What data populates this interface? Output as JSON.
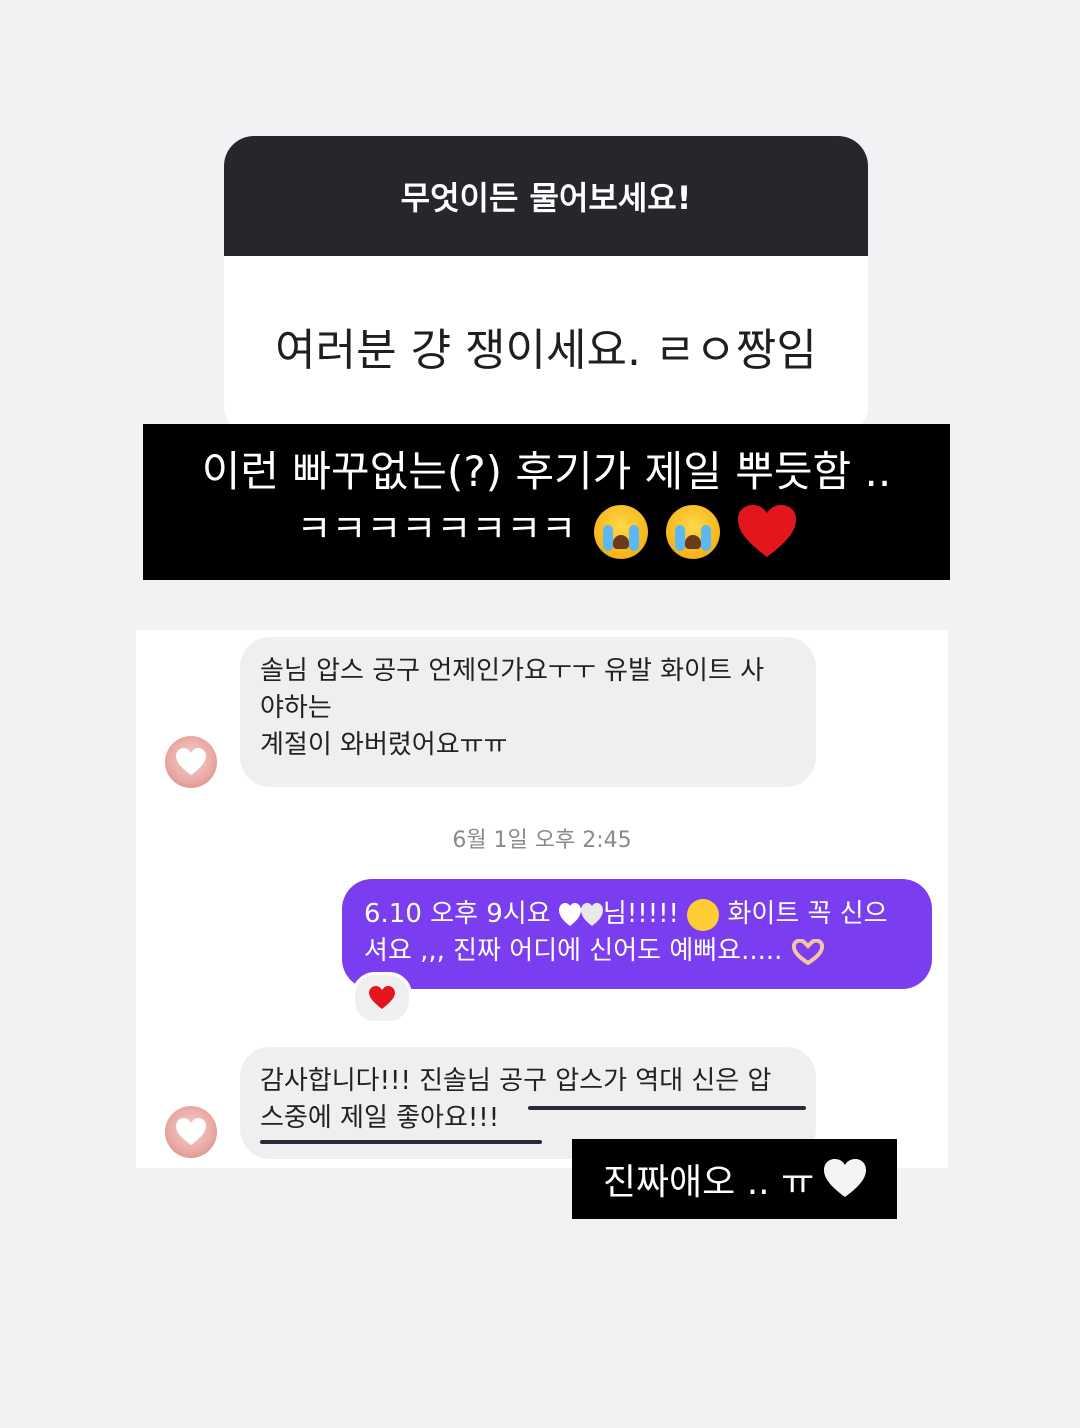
{
  "question_sticker": {
    "prompt": "무엇이든 물어보세요!",
    "answer": "여러분 걍 쟁이세요. ㄹㅇ짱임"
  },
  "banner": {
    "line1": "이런 빠꾸없는(?) 후기가 제일 뿌듯함 ..",
    "line2": "ㅋㅋㅋㅋㅋㅋㅋㅋ",
    "emojis": [
      "crying-face-icon",
      "crying-face-icon",
      "red-heart-icon"
    ]
  },
  "chat": {
    "messages": [
      {
        "from": "them",
        "lines": [
          "솔님 압스 공구 언제인가요ㅜㅜ 유발 화이트 사",
          "야하는",
          "계절이 와버렸어요ㅠㅠ"
        ]
      },
      {
        "from": "me",
        "lines": [
          "6.10 오후 9시요",
          "님!!!!!",
          "화이트 꼭 신으",
          "셔요 ,,, 진짜 어디에 신어도 예뻐요....."
        ],
        "reaction": "red-heart-icon"
      },
      {
        "from": "them",
        "lines": [
          "감사합니다!!! 진솔님 공구 압스가 역대 신은 압",
          "스중에 제일 좋아요!!!"
        ]
      }
    ],
    "timestamp": "6월 1일 오후 2:45"
  },
  "caption2": {
    "text": "진짜애오 .. ㅠ",
    "emoji": "white-heart-icon"
  },
  "colors": {
    "background": "#f2f2f4",
    "sticker_header": "#26272c",
    "outgoing_bubble": "#7b3df0",
    "incoming_bubble": "#efefef"
  }
}
